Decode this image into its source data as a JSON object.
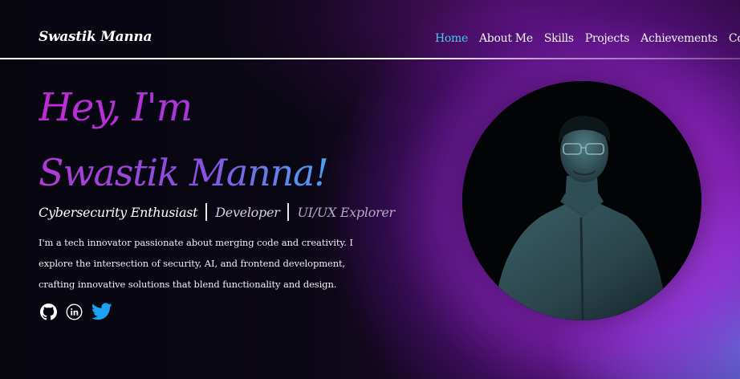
{
  "header": {
    "logo": "Swastik Manna",
    "nav": [
      {
        "label": "Home",
        "active": true
      },
      {
        "label": "About Me",
        "active": false
      },
      {
        "label": "Skills",
        "active": false
      },
      {
        "label": "Projects",
        "active": false
      },
      {
        "label": "Achievements",
        "active": false
      },
      {
        "label": "Contact",
        "active": false
      }
    ]
  },
  "hero": {
    "greeting": "Hey, I'm",
    "name": "Swastik Manna!",
    "roles": [
      "Cybersecurity Enthusiast",
      "Developer",
      "UI/UX Explorer"
    ],
    "bio": "I'm a tech innovator passionate about merging code and creativity. I explore the intersection of security, AI, and frontend development, crafting innovative solutions that blend functionality and design."
  },
  "socials": [
    {
      "icon": "github-icon"
    },
    {
      "icon": "linkedin-icon"
    },
    {
      "icon": "twitter-icon"
    }
  ],
  "colors": {
    "accent_nav_active": "#48c8f0",
    "twitter_blue": "#1da1f2",
    "gradient_pink": "#c02ad6",
    "gradient_blue": "#4aa0f2"
  }
}
